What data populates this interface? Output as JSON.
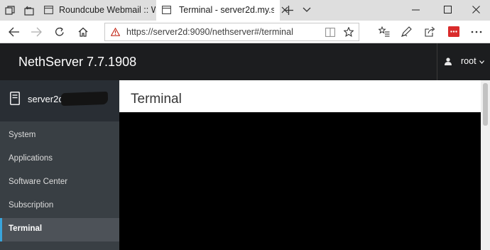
{
  "browser": {
    "tabs": [
      {
        "title": "Roundcube Webmail :: Welc",
        "active": false
      },
      {
        "title": "Terminal - server2d.my.s",
        "active": true
      }
    ],
    "address": {
      "url": "https://server2d:9090/nethserver#/terminal"
    },
    "icons": {
      "tab_actions": "tab-actions-icon",
      "restore_tabs": "restore-tabs-icon",
      "back": "back-arrow-icon",
      "forward": "forward-arrow-icon",
      "refresh": "refresh-icon",
      "home": "home-icon",
      "security": "warning-icon",
      "reading_view": "reading-view-icon",
      "favorite": "star-icon",
      "favorites_hub": "favorites-hub-icon",
      "pen": "pen-icon",
      "share": "share-icon",
      "extension": "extension-icon",
      "more": "more-icon"
    },
    "extension_color": "#d92b2b"
  },
  "app": {
    "brand": "NethServer 7.7.1908",
    "user": {
      "name": "root",
      "icon": "user-icon",
      "chevron": "chevron-down-icon"
    },
    "host": {
      "name": "server2d.",
      "icon": "server-icon"
    },
    "nav": [
      {
        "label": "System",
        "active": false
      },
      {
        "label": "Applications",
        "active": false
      },
      {
        "label": "Software Center",
        "active": false
      },
      {
        "label": "Subscription",
        "active": false
      },
      {
        "label": "Terminal",
        "active": true
      }
    ],
    "page_title": "Terminal",
    "accent_color": "#39a5dc"
  }
}
